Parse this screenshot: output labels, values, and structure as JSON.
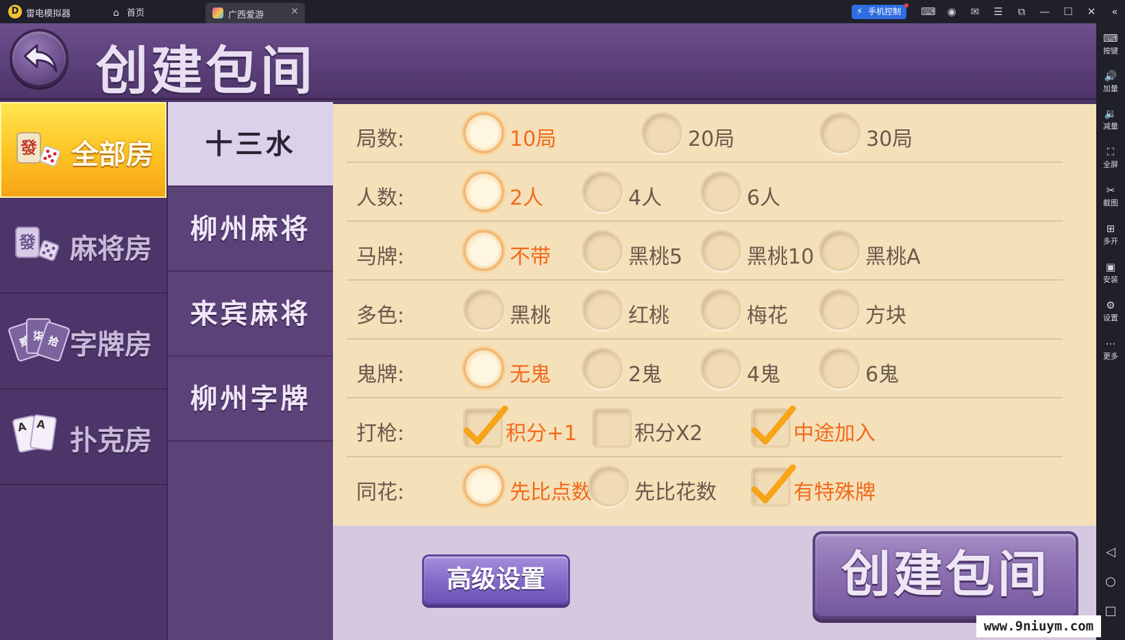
{
  "emulator": {
    "app_name": "雷电模拟器",
    "home_tab": "首页",
    "active_tab": "广西爱游",
    "phone_control": "手机控制",
    "toolbar": [
      {
        "label": "按键",
        "icon": "keyboard-icon"
      },
      {
        "label": "加量",
        "icon": "volume-up-icon"
      },
      {
        "label": "减量",
        "icon": "volume-down-icon"
      },
      {
        "label": "全屏",
        "icon": "fullscreen-icon"
      },
      {
        "label": "截图",
        "icon": "scissors-icon"
      },
      {
        "label": "多开",
        "icon": "multi-instance-icon"
      },
      {
        "label": "安装",
        "icon": "apk-install-icon"
      },
      {
        "label": "设置",
        "icon": "gear-icon"
      },
      {
        "label": "更多",
        "icon": "more-icon"
      }
    ]
  },
  "page": {
    "title": "创建包间"
  },
  "categories": [
    {
      "label": "全部房",
      "icon": "mahjong-dice-icon",
      "active": true
    },
    {
      "label": "麻将房",
      "icon": "mahjong-dice-icon",
      "active": false
    },
    {
      "label": "字牌房",
      "icon": "word-cards-icon",
      "active": false
    },
    {
      "label": "扑克房",
      "icon": "poker-cards-icon",
      "active": false
    }
  ],
  "category_icon_text": {
    "mahjong": "發",
    "cards": [
      "贰",
      "柒",
      "拾"
    ],
    "poker": [
      "A",
      "A"
    ]
  },
  "games": [
    {
      "label": "十三水",
      "active": true
    },
    {
      "label": "柳州麻将",
      "active": false
    },
    {
      "label": "来宾麻将",
      "active": false
    },
    {
      "label": "柳州字牌",
      "active": false
    }
  ],
  "options": [
    {
      "label": "局数:",
      "type": "radio",
      "choices": [
        {
          "text": "10局",
          "selected": true
        },
        {
          "text": "20局",
          "selected": false
        },
        {
          "text": "30局",
          "selected": false
        }
      ]
    },
    {
      "label": "人数:",
      "type": "radio",
      "choices": [
        {
          "text": "2人",
          "selected": true
        },
        {
          "text": "4人",
          "selected": false
        },
        {
          "text": "6人",
          "selected": false
        }
      ]
    },
    {
      "label": "马牌:",
      "type": "radio",
      "choices": [
        {
          "text": "不带",
          "selected": true
        },
        {
          "text": "黑桃5",
          "selected": false
        },
        {
          "text": "黑桃10",
          "selected": false
        },
        {
          "text": "黑桃A",
          "selected": false
        }
      ]
    },
    {
      "label": "多色:",
      "type": "radio",
      "choices": [
        {
          "text": "黑桃",
          "selected": false
        },
        {
          "text": "红桃",
          "selected": false
        },
        {
          "text": "梅花",
          "selected": false
        },
        {
          "text": "方块",
          "selected": false
        }
      ]
    },
    {
      "label": "鬼牌:",
      "type": "radio",
      "choices": [
        {
          "text": "无鬼",
          "selected": true
        },
        {
          "text": "2鬼",
          "selected": false
        },
        {
          "text": "4鬼",
          "selected": false
        },
        {
          "text": "6鬼",
          "selected": false
        }
      ]
    },
    {
      "label": "打枪:",
      "type": "checkbox",
      "choices": [
        {
          "text": "积分+1",
          "selected": true
        },
        {
          "text": "积分X2",
          "selected": false
        },
        {
          "text": "中途加入",
          "selected": true
        }
      ]
    },
    {
      "label": "同花:",
      "type": "mixed",
      "choices": [
        {
          "text": "先比点数",
          "selected": true,
          "control": "radio"
        },
        {
          "text": "先比花数",
          "selected": false,
          "control": "radio"
        },
        {
          "text": "有特殊牌",
          "selected": true,
          "control": "checkbox"
        }
      ]
    }
  ],
  "buttons": {
    "advanced": "高级设置",
    "create": "创建包间"
  },
  "watermark": "www.9niuym.com",
  "colors": {
    "selected_text": "#f26a1b",
    "normal_text": "#6a5a4c",
    "panel_bg": "#f4e0b9",
    "accent_yellow": "#fdc322",
    "purple": "#5b4278"
  }
}
